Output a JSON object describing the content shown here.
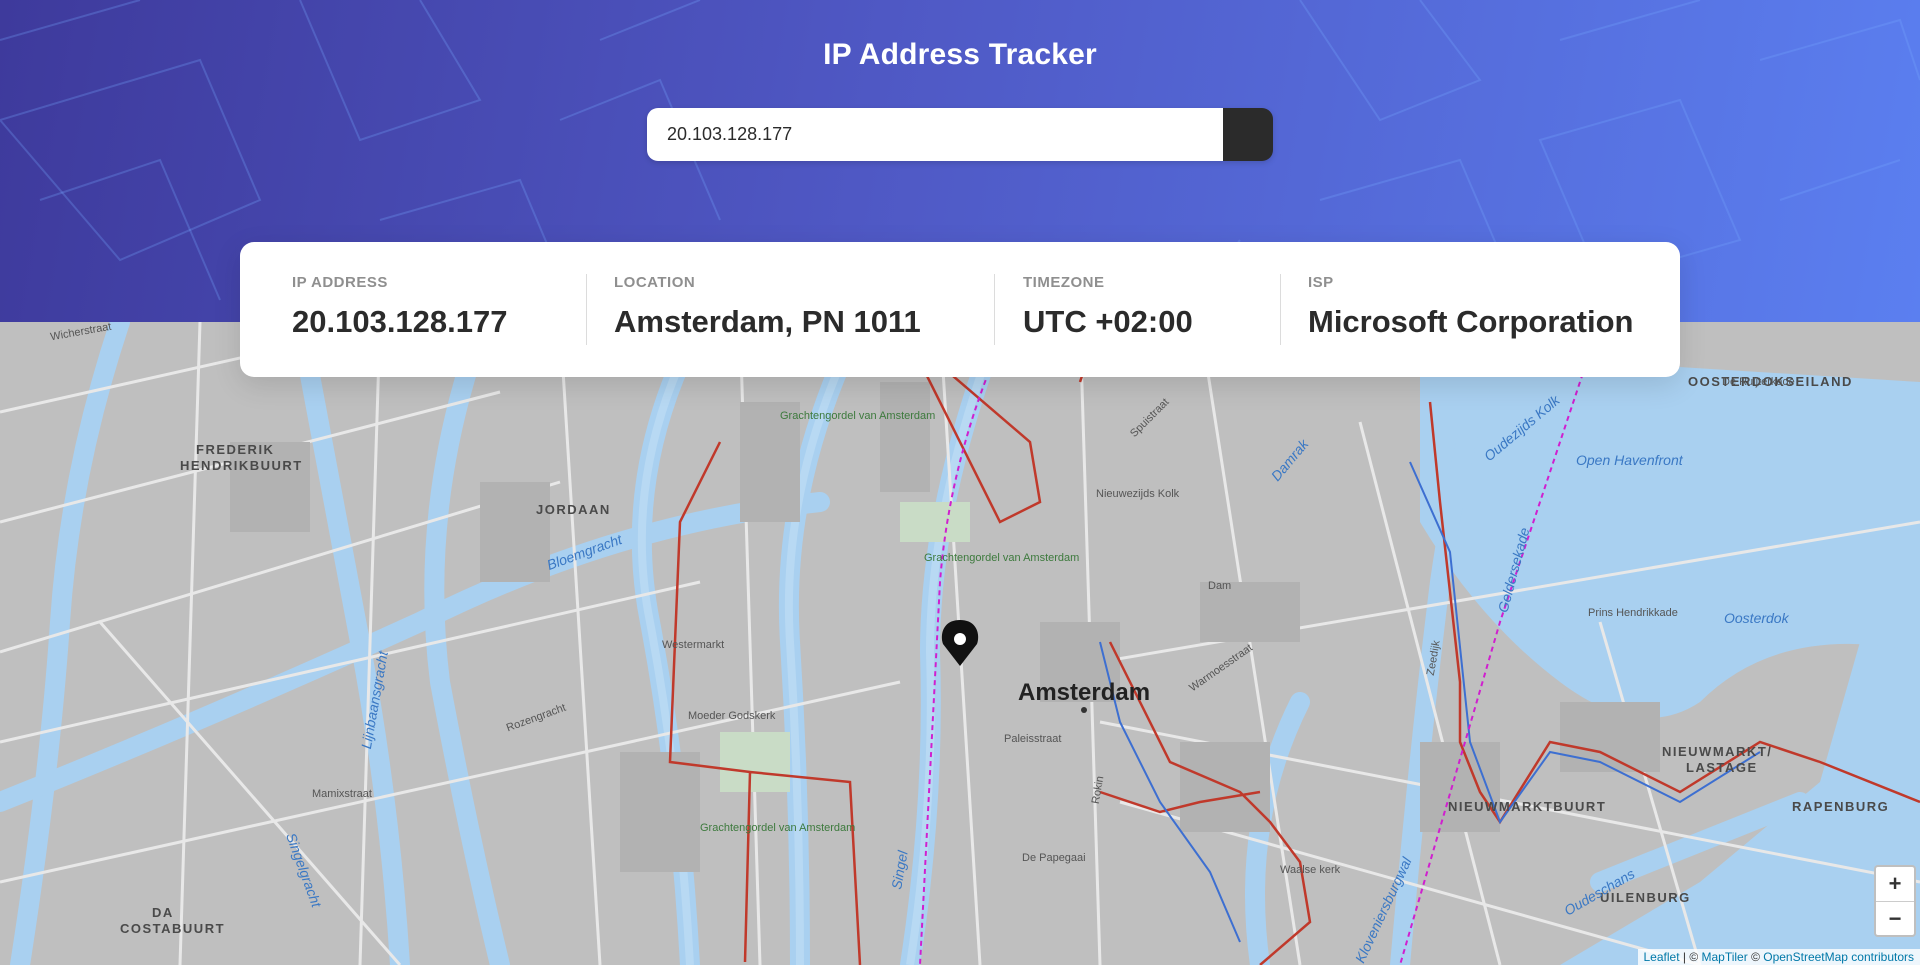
{
  "header": {
    "title": "IP Address Tracker",
    "search_value": "20.103.128.177",
    "submit_icon": "chevron-right-icon"
  },
  "info": {
    "ip": {
      "label": "IP ADDRESS",
      "value": "20.103.128.177"
    },
    "location": {
      "label": "LOCATION",
      "value": "Amsterdam, PN 1011"
    },
    "timezone": {
      "label": "TIMEZONE",
      "value": "UTC +02:00"
    },
    "isp": {
      "label": "ISP",
      "value": "Microsoft Corporation"
    }
  },
  "map": {
    "city_label": "Amsterdam",
    "marker_icon": "location-pin-icon",
    "labels": {
      "frederik": "FREDERIK",
      "hendrikbuurt": "HENDRIKBUURT",
      "jordaan": "JORDAAN",
      "da": "DA",
      "costabuurt": "COSTABUURT",
      "oosterdokseiland": "OOSTERDOKSEILAND",
      "nieuwmarkt": "NIEUWMARKT/",
      "lastage": "LASTAGE",
      "nieuwmarktbuurt": "NIEUWMARKTBUURT",
      "rapenburg": "RAPENBURG",
      "uilenburg": "UILENBURG",
      "bloemgracht": "Bloemgracht",
      "lijnbaansgracht": "Lijnbaansgracht",
      "singel": "Singel",
      "singelgracht": "Singelgracht",
      "damrak": "Damrak",
      "oudezijds_kolk": "Oudezijds Kolk",
      "open_havenfront": "Open Havenfront",
      "oosterdok": "Oosterdok",
      "geldersekade": "Geldersekade",
      "oudeschans": "Oudeschans",
      "grachtengordel": "Grachtengordel van Amsterdam",
      "westermarkt": "Westermarkt",
      "moeder_godskerk": "Moeder Godskerk",
      "de_papegaai": "De Papegaai",
      "waalse_kerk": "Waalse kerk",
      "prins_hendrikkade": "Prins Hendrikkade",
      "paleisstraat": "Paleisstraat",
      "spuistraat": "Spuistraat",
      "nieuwezijds_kolk": "Nieuwezijds Kolk",
      "de_ruijterkade": "De Ruijterkade",
      "rozengracht": "Rozengracht",
      "wicherstraat": "Wicherstraat",
      "mamixstraat": "Mamixstraat",
      "dam": "Dam",
      "rokin": "Rokin",
      "warmoesstraat": "Warmoesstraat",
      "zeedijk": "Zeedijk",
      "kloveniersburgwal": "Kloveniersburgwal"
    },
    "zoom_in": "+",
    "zoom_out": "−",
    "attribution": {
      "leaflet": "Leaflet",
      "sep1": " | © ",
      "maptiler": "MapTiler",
      "sep2": " © ",
      "osm": "OpenStreetMap contributors"
    }
  }
}
